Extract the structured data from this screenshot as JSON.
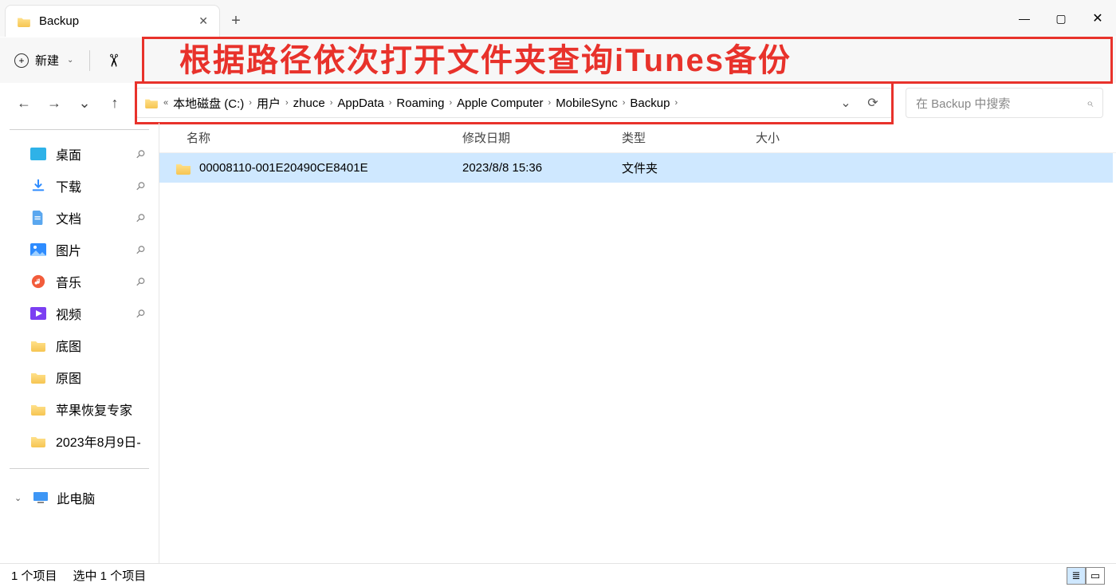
{
  "window": {
    "tab_title": "Backup",
    "minimize": "—",
    "maximize": "▢",
    "close": "✕",
    "newtab": "+",
    "tab_close": "✕"
  },
  "annotation": "根据路径依次打开文件夹查询iTunes备份",
  "toolbar": {
    "new_label": "新建",
    "cut": "✂"
  },
  "nav": {
    "back": "←",
    "forward": "→",
    "dropdown": "⌄",
    "up": "↑",
    "history_chev": "⌄",
    "refresh": "⟳"
  },
  "breadcrumb": [
    "本地磁盘 (C:)",
    "用户",
    "zhuce",
    "AppData",
    "Roaming",
    "Apple Computer",
    "MobileSync",
    "Backup"
  ],
  "search": {
    "placeholder": "在 Backup 中搜索",
    "icon": "⌕"
  },
  "columns": {
    "name": "名称",
    "date": "修改日期",
    "type": "类型",
    "size": "大小"
  },
  "rows": [
    {
      "name": "00008110-001E20490CE8401E",
      "date": "2023/8/8 15:36",
      "type": "文件夹",
      "size": ""
    }
  ],
  "sidebar": {
    "items": [
      {
        "label": "桌面",
        "icon": "desktop",
        "pinned": true
      },
      {
        "label": "下载",
        "icon": "download",
        "pinned": true
      },
      {
        "label": "文档",
        "icon": "doc",
        "pinned": true
      },
      {
        "label": "图片",
        "icon": "picture",
        "pinned": true
      },
      {
        "label": "音乐",
        "icon": "music",
        "pinned": true
      },
      {
        "label": "视频",
        "icon": "video",
        "pinned": true
      },
      {
        "label": "底图",
        "icon": "folder",
        "pinned": false
      },
      {
        "label": "原图",
        "icon": "folder",
        "pinned": false
      },
      {
        "label": "苹果恢复专家",
        "icon": "folder",
        "pinned": false
      },
      {
        "label": "2023年8月9日-",
        "icon": "folder",
        "pinned": false
      }
    ],
    "pc_label": "此电脑",
    "pc_chevron": "⌄"
  },
  "status": {
    "count": "1 个项目",
    "selected": "选中 1 个项目"
  }
}
